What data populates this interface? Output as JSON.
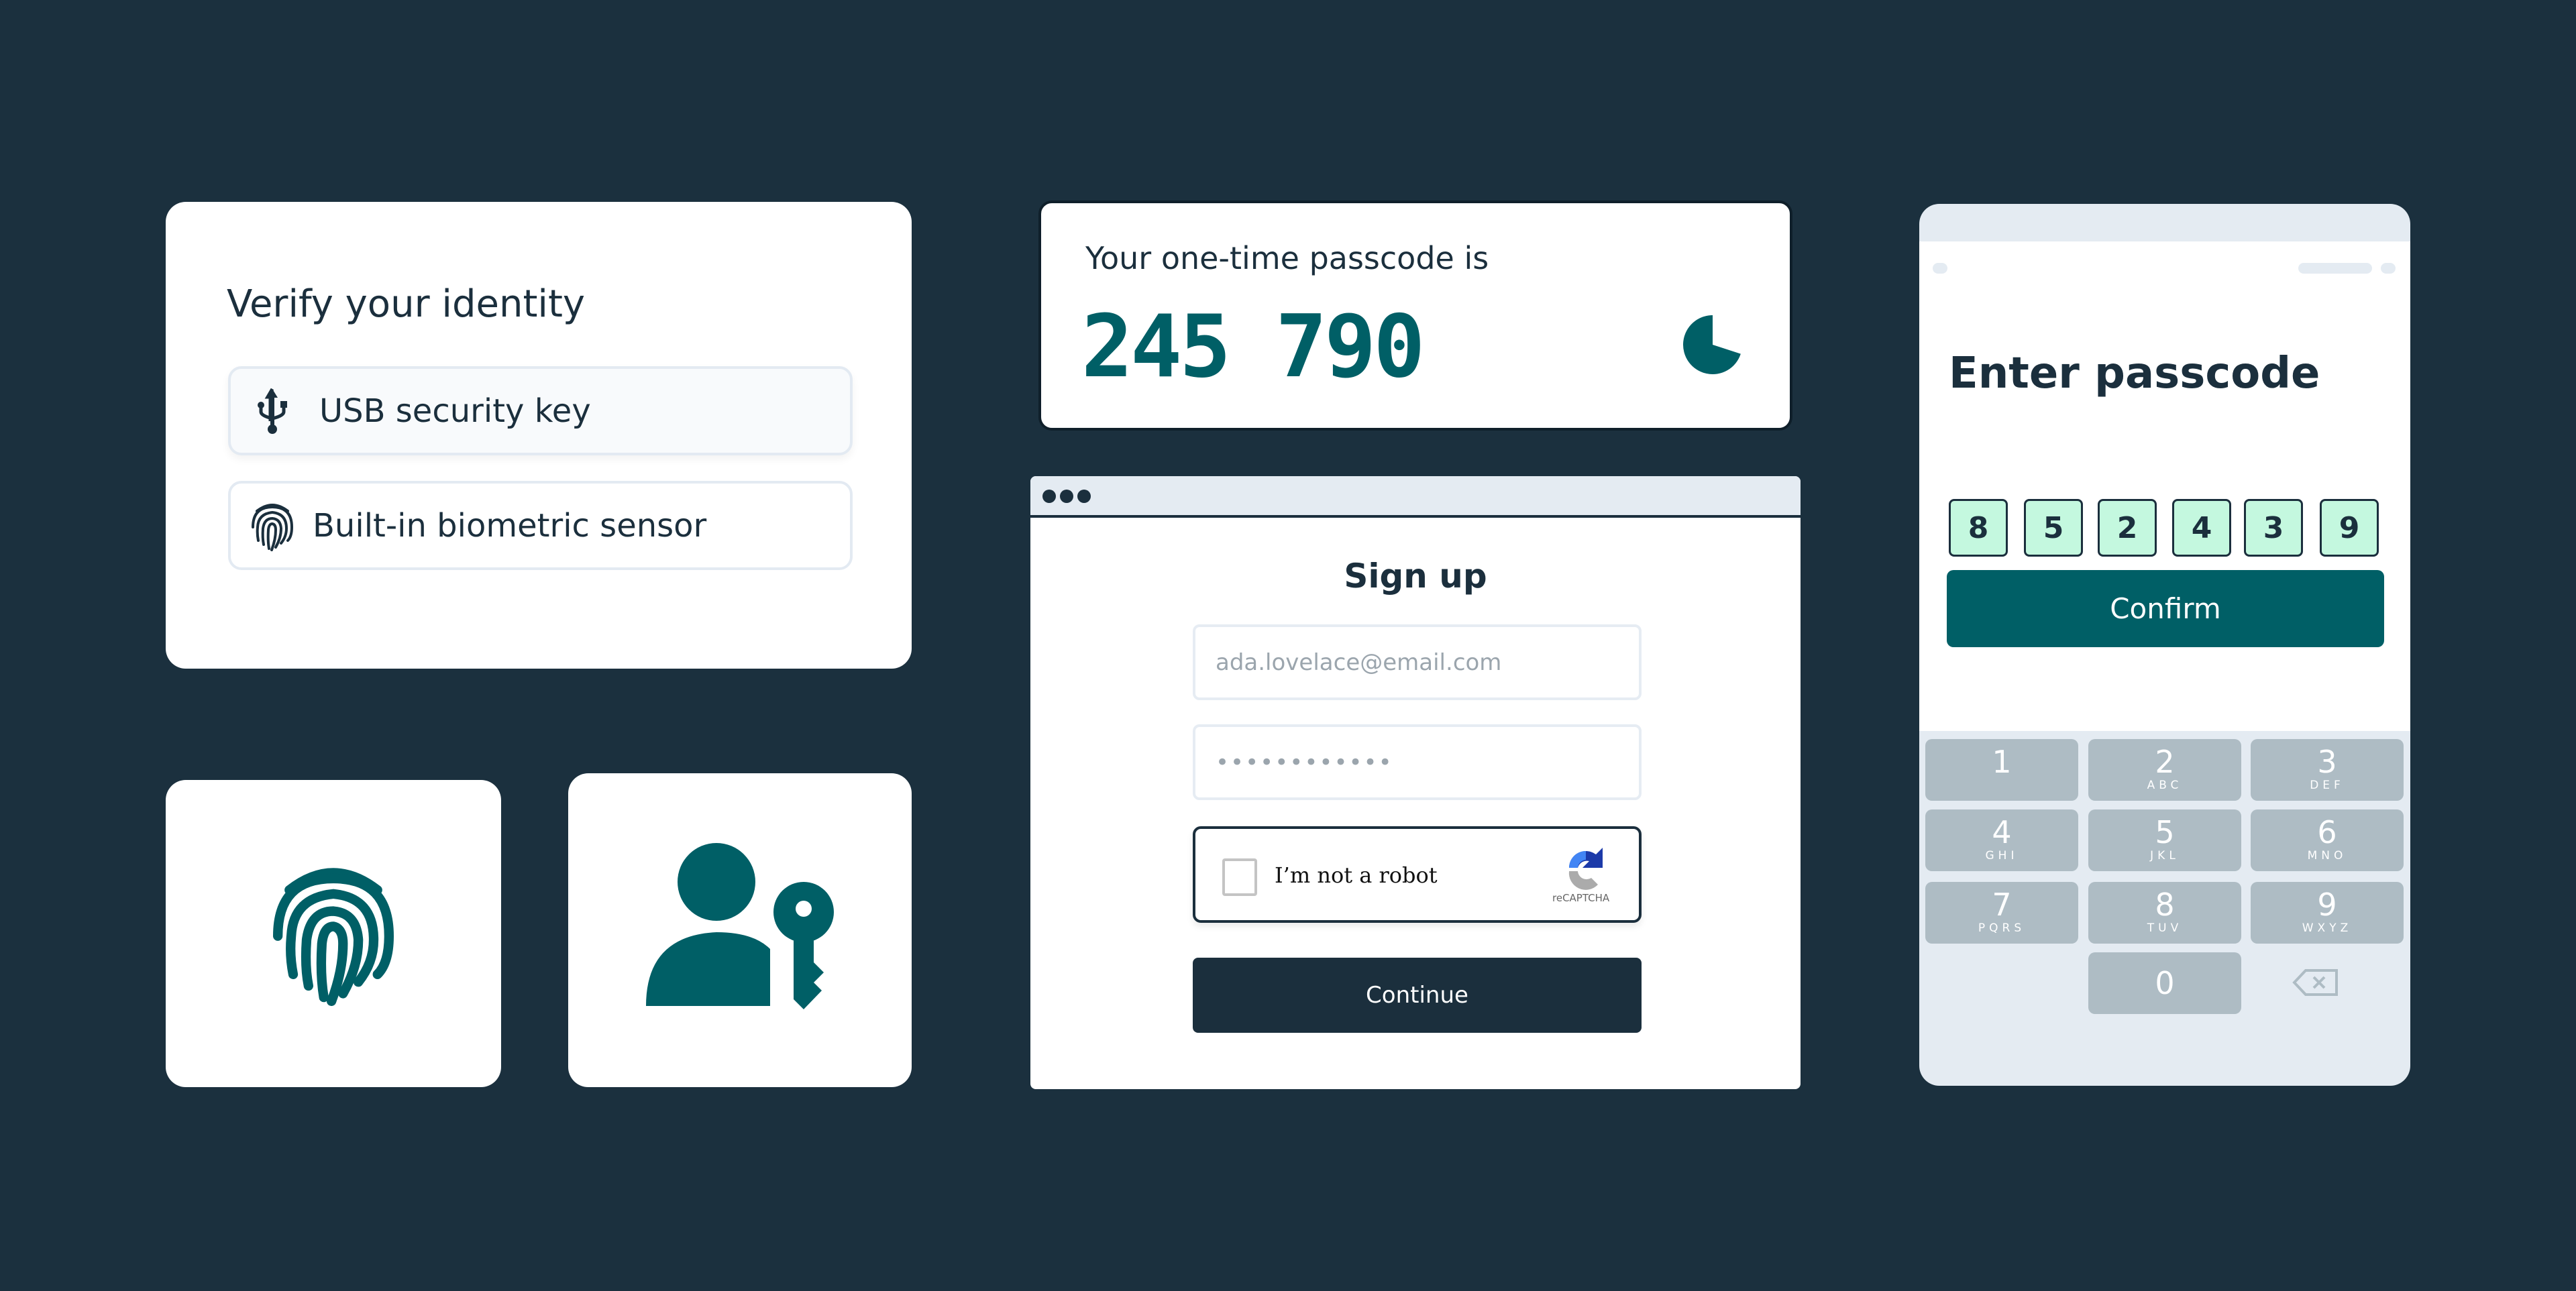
{
  "colors": {
    "background": "#1b303e",
    "teal": "#005f66",
    "navy": "#1b2f3d",
    "code_box": "#c4f8df",
    "key": "#aebcc4"
  },
  "verify": {
    "title": "Verify your identity",
    "options": [
      {
        "label": "USB security key",
        "icon": "usb-icon"
      },
      {
        "label": "Built-in biometric sensor",
        "icon": "fingerprint-icon"
      }
    ]
  },
  "tiles": [
    {
      "icon": "fingerprint-icon"
    },
    {
      "icon": "user-key-icon"
    }
  ],
  "otp": {
    "title": "Your one-time passcode is",
    "code_part1": "245",
    "code_part2": "790",
    "timer_icon": "pie-timer-icon",
    "timer_remaining": 0.7
  },
  "signup": {
    "title": "Sign up",
    "email_placeholder": "ada.lovelace@email.com",
    "password_value": "••••••••••••",
    "captcha_label": "I’m not a robot",
    "captcha_brand": "reCAPTCHA",
    "continue_label": "Continue"
  },
  "phone": {
    "title": "Enter passcode",
    "digits": [
      "8",
      "5",
      "2",
      "4",
      "3",
      "9"
    ],
    "confirm_label": "Confirm",
    "keys": [
      {
        "n": "1",
        "l": ""
      },
      {
        "n": "2",
        "l": "ABC"
      },
      {
        "n": "3",
        "l": "DEF"
      },
      {
        "n": "4",
        "l": "GHI"
      },
      {
        "n": "5",
        "l": "JKL"
      },
      {
        "n": "6",
        "l": "MNO"
      },
      {
        "n": "7",
        "l": "PQRS"
      },
      {
        "n": "8",
        "l": "TUV"
      },
      {
        "n": "9",
        "l": "WXYZ"
      },
      {
        "n": "0",
        "l": ""
      }
    ]
  }
}
